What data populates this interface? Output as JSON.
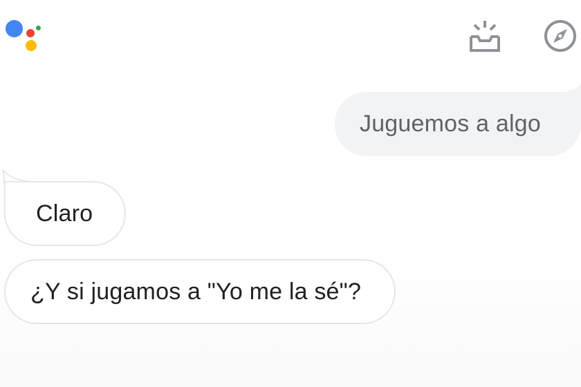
{
  "header": {
    "logo_colors": {
      "blue": "#4285f4",
      "red": "#ea4335",
      "yellow": "#fbbc05",
      "green": "#34a853"
    },
    "actions": [
      {
        "icon": "snapshot-icon"
      },
      {
        "icon": "explore-compass-icon"
      }
    ],
    "icon_color": "#8e9196"
  },
  "conversation": {
    "messages": [
      {
        "from": "user",
        "text": "Juguemos a algo"
      },
      {
        "from": "assistant",
        "text": "Claro"
      },
      {
        "from": "assistant",
        "text": "¿Y si jugamos a \"Yo me la sé\"?"
      }
    ]
  },
  "colors": {
    "user_bubble_bg": "#f1f3f4",
    "user_text": "#5f6368",
    "assistant_border": "#e6e6e6",
    "assistant_text": "#202124"
  }
}
